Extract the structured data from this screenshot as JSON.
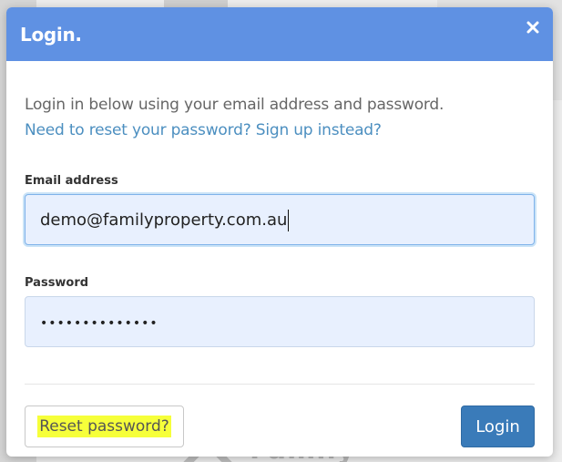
{
  "modal": {
    "title": "Login.",
    "close_icon": "close-icon",
    "intro_text": "Login in below using your email address and password.",
    "reset_link": "Need to reset your password?",
    "signup_link": "Sign up instead?"
  },
  "form": {
    "email_label": "Email address",
    "email_value": "demo@familyproperty.com.au",
    "password_label": "Password",
    "password_masked": "••••••••••••••"
  },
  "footer": {
    "reset_button": "Reset password?",
    "login_button": "Login"
  },
  "background": {
    "logo_text": "Family"
  },
  "colors": {
    "header": "#5f91e3",
    "link": "#4c8fc0",
    "primary_button": "#3a7bb9",
    "input_bg": "#e8f0fe",
    "highlight": "#f6ff3a"
  }
}
